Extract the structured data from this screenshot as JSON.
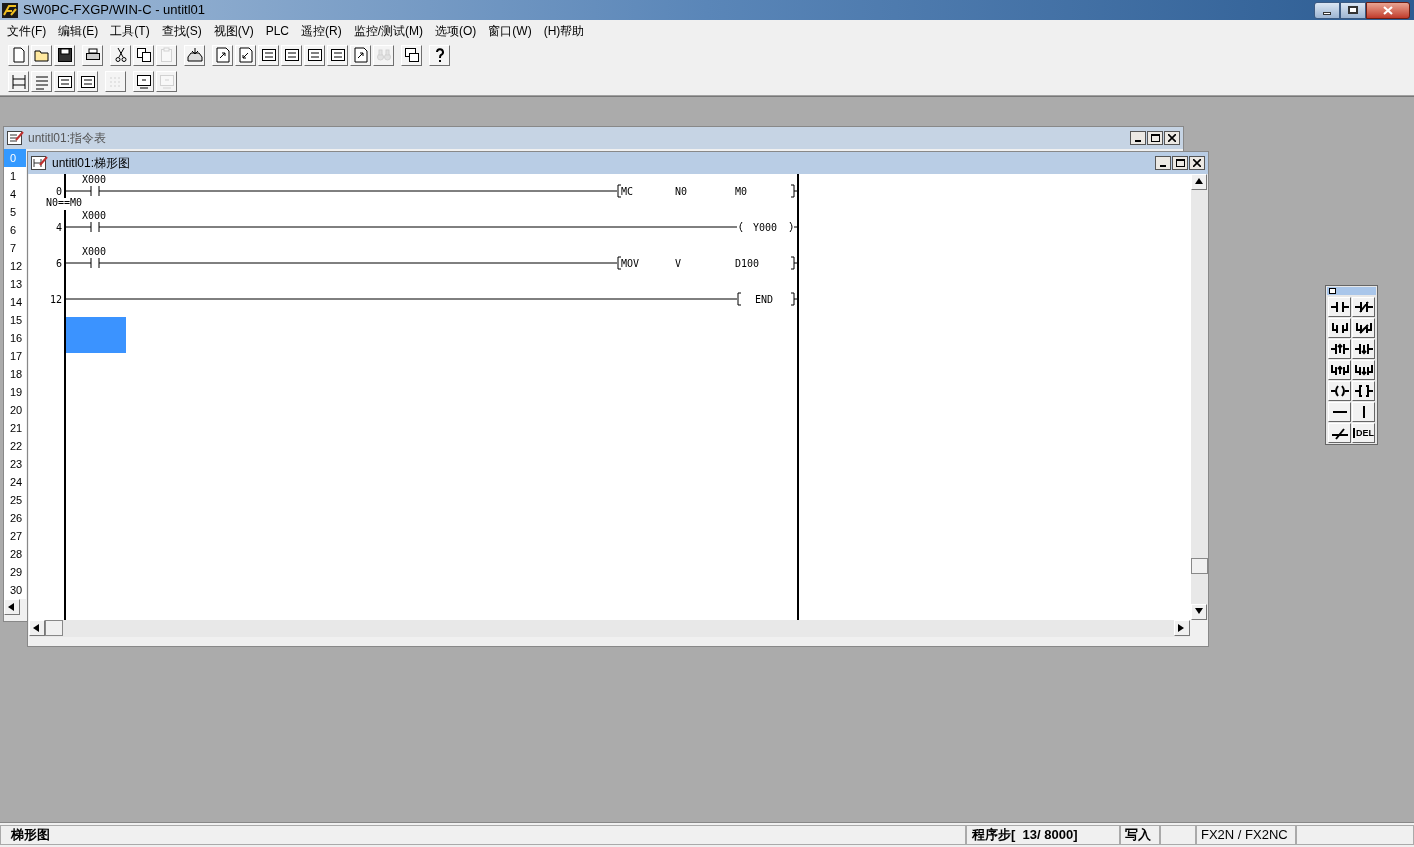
{
  "window": {
    "title": "SW0PC-FXGP/WIN-C - untitl01"
  },
  "menu": [
    "文件(F)",
    "编辑(E)",
    "工具(T)",
    "查找(S)",
    "视图(V)",
    "PLC",
    "遥控(R)",
    "监控/测试(M)",
    "选项(O)",
    "窗口(W)",
    "(H)帮助"
  ],
  "toolbar_1": [
    [
      {
        "kind": "new",
        "disabled": false
      },
      {
        "kind": "open",
        "disabled": false
      },
      {
        "kind": "save",
        "disabled": false
      }
    ],
    [
      {
        "kind": "print",
        "disabled": false
      }
    ],
    [
      {
        "kind": "cut",
        "disabled": false
      },
      {
        "kind": "copy",
        "disabled": false
      },
      {
        "kind": "paste",
        "disabled": true
      }
    ],
    [
      {
        "kind": "transfer",
        "disabled": false
      }
    ],
    [
      {
        "kind": "page_up",
        "disabled": false
      },
      {
        "kind": "page_down",
        "disabled": false
      },
      {
        "kind": "symbol",
        "disabled": false
      },
      {
        "kind": "symbol",
        "disabled": false
      },
      {
        "kind": "symbol",
        "disabled": false
      },
      {
        "kind": "symbol",
        "disabled": false
      },
      {
        "kind": "page_up",
        "disabled": false
      },
      {
        "kind": "find",
        "disabled": true
      }
    ],
    [
      {
        "kind": "windows",
        "disabled": false
      }
    ],
    [
      {
        "kind": "help",
        "disabled": false
      }
    ]
  ],
  "toolbar_2": [
    [
      {
        "kind": "ladder",
        "disabled": false
      },
      {
        "kind": "list",
        "disabled": false
      },
      {
        "kind": "symbol",
        "disabled": false
      },
      {
        "kind": "symbol",
        "disabled": false
      }
    ],
    [
      {
        "kind": "grid",
        "disabled": true
      }
    ],
    [
      {
        "kind": "monitor",
        "disabled": false
      },
      {
        "kind": "monitor",
        "disabled": true
      }
    ]
  ],
  "list_window": {
    "title": "untitl01:指令表",
    "steps": [
      {
        "text": "0",
        "selected": true
      },
      {
        "text": "1",
        "selected": false
      },
      {
        "text": "4",
        "selected": false
      },
      {
        "text": "5",
        "selected": false
      },
      {
        "text": "6",
        "selected": false
      },
      {
        "text": "7",
        "selected": false
      },
      {
        "text": "12",
        "selected": false
      },
      {
        "text": "13",
        "selected": false
      },
      {
        "text": "14",
        "selected": false
      },
      {
        "text": "15",
        "selected": false
      },
      {
        "text": "16",
        "selected": false
      },
      {
        "text": "17",
        "selected": false
      },
      {
        "text": "18",
        "selected": false
      },
      {
        "text": "19",
        "selected": false
      },
      {
        "text": "20",
        "selected": false
      },
      {
        "text": "21",
        "selected": false
      },
      {
        "text": "22",
        "selected": false
      },
      {
        "text": "23",
        "selected": false
      },
      {
        "text": "24",
        "selected": false
      },
      {
        "text": "25",
        "selected": false
      },
      {
        "text": "26",
        "selected": false
      },
      {
        "text": "27",
        "selected": false
      },
      {
        "text": "28",
        "selected": false
      },
      {
        "text": "29",
        "selected": false
      },
      {
        "text": "30",
        "selected": false
      }
    ]
  },
  "ladder_window": {
    "title": "untitl01:梯形图",
    "rungs": [
      {
        "step": "0",
        "contact": "X000",
        "note": "N0==M0",
        "output": {
          "kind": "apply",
          "operands": [
            "MC",
            "N0",
            "M0"
          ]
        }
      },
      {
        "step": "4",
        "contact": "X000",
        "output": {
          "kind": "coil",
          "operands": [
            "Y000"
          ]
        }
      },
      {
        "step": "6",
        "contact": "X000",
        "output": {
          "kind": "apply",
          "operands": [
            "MOV",
            "V",
            "D100"
          ]
        }
      },
      {
        "step": "12",
        "output": {
          "kind": "end",
          "operands": [
            "END"
          ]
        }
      }
    ]
  },
  "palette": [
    {
      "kind": "no"
    },
    {
      "kind": "nc"
    },
    {
      "kind": "or_no"
    },
    {
      "kind": "or_nc"
    },
    {
      "kind": "rise"
    },
    {
      "kind": "fall"
    },
    {
      "kind": "or_rise"
    },
    {
      "kind": "or_fall"
    },
    {
      "kind": "coil"
    },
    {
      "kind": "apply"
    },
    {
      "kind": "hline"
    },
    {
      "kind": "vline"
    },
    {
      "kind": "delete_line"
    },
    {
      "kind": "del",
      "label": "DEL"
    }
  ],
  "status_bar": {
    "mode": "梯形图",
    "step": "程序步[  13/ 8000]",
    "write_mode": "写入",
    "model": "FX2N / FX2NC"
  }
}
